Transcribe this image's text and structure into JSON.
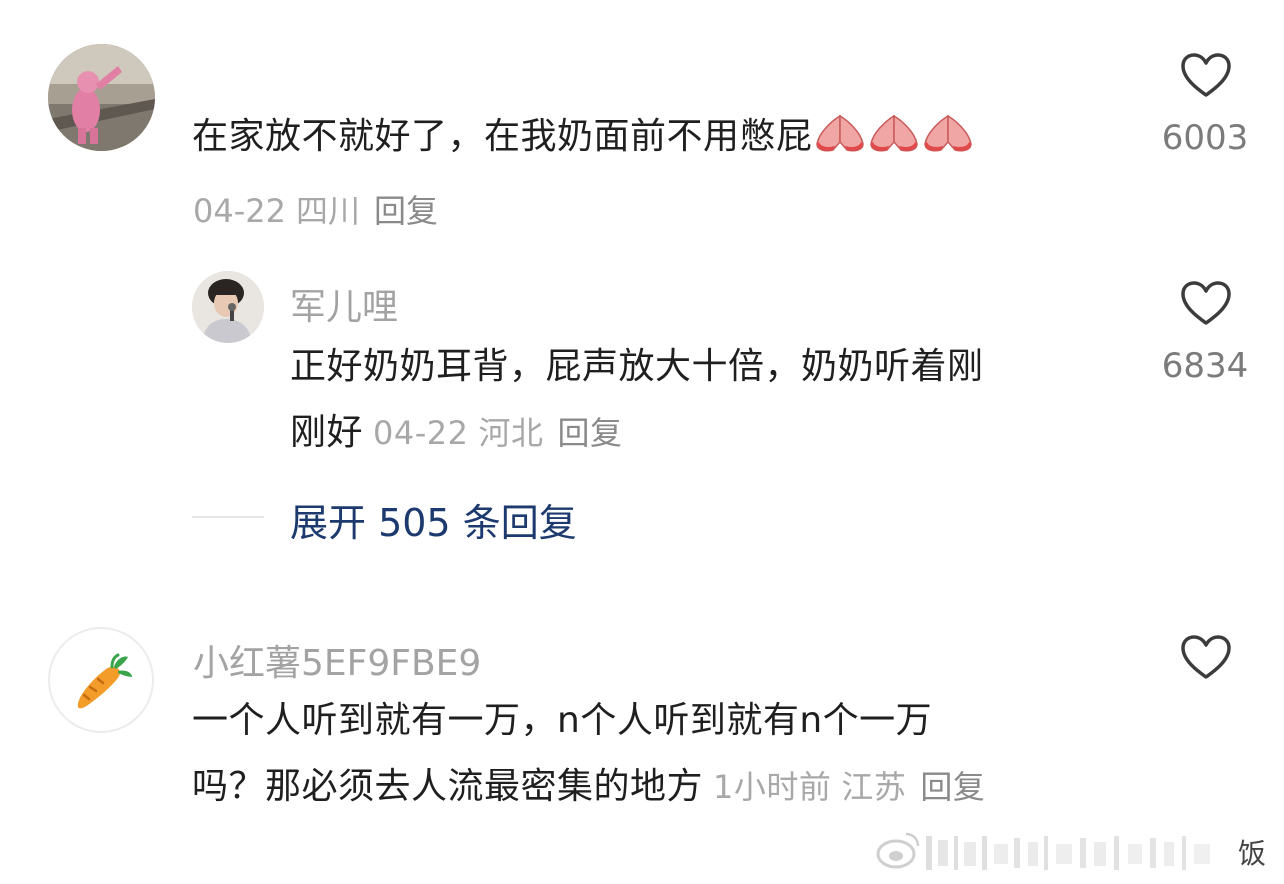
{
  "comments": [
    {
      "text": "在家放不就好了，在我奶面前不用憋屁",
      "emoji_count": 3,
      "date": "04-22",
      "location": "四川",
      "reply_label": "回复",
      "likes": "6003",
      "replies": [
        {
          "author": "军儿哩",
          "text_line1": "正好奶奶耳背，屁声放大十倍，奶奶听着刚",
          "text_line2": "刚好",
          "date": "04-22",
          "location": "河北",
          "reply_label": "回复",
          "likes": "6834"
        }
      ],
      "expand_label": "展开 505 条回复"
    },
    {
      "author": "小红薯5EF9FBE9",
      "text_line1": "一个人听到就有一万，n个人听到就有n个一万",
      "text_line2": "吗？那必须去人流最密集的地方",
      "time": "1小时前",
      "location": "江苏",
      "reply_label": "回复",
      "likes": ""
    }
  ],
  "watermark": {
    "text": "饭"
  },
  "colors": {
    "text": "#1f1f1f",
    "meta": "#a8a8a8",
    "link": "#1d3a6e",
    "heart": "#3c3c3c"
  }
}
